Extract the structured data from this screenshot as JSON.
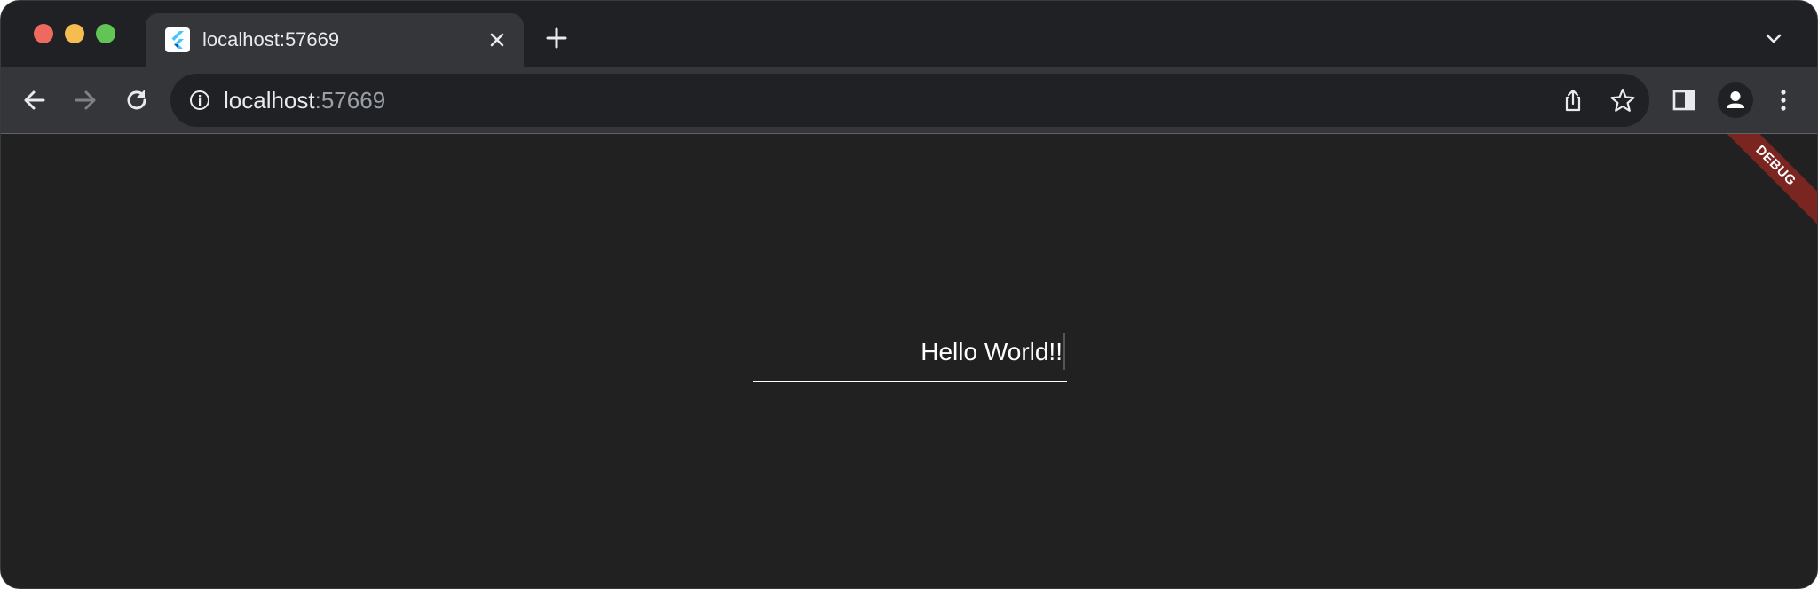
{
  "window": {
    "controls": [
      "close",
      "minimize",
      "maximize"
    ]
  },
  "tab": {
    "title": "localhost:57669",
    "favicon": "flutter-icon",
    "close_icon": "close-icon"
  },
  "tabstrip": {
    "new_tab_icon": "plus-icon",
    "tab_search_icon": "chevron-down-icon"
  },
  "toolbar": {
    "back_icon": "arrow-left-icon",
    "forward_icon": "arrow-right-icon",
    "reload_icon": "reload-icon",
    "side_panel_icon": "side-panel-icon",
    "profile_icon": "profile-icon",
    "menu_icon": "kebab-menu-icon"
  },
  "omnibox": {
    "info_icon": "info-icon",
    "host": "localhost",
    "port": ":57669",
    "share_icon": "share-icon",
    "bookmark_icon": "star-icon"
  },
  "content": {
    "debug_banner": "DEBUG",
    "text_field_value": "Hello World!!"
  },
  "colors": {
    "content_background": "#212121",
    "tab_strip": "#202124",
    "toolbar": "#35363a",
    "debug_banner": "#7b2521",
    "traffic_red": "#ee6a5f",
    "traffic_yellow": "#f5bd4f",
    "traffic_green": "#61c454"
  }
}
